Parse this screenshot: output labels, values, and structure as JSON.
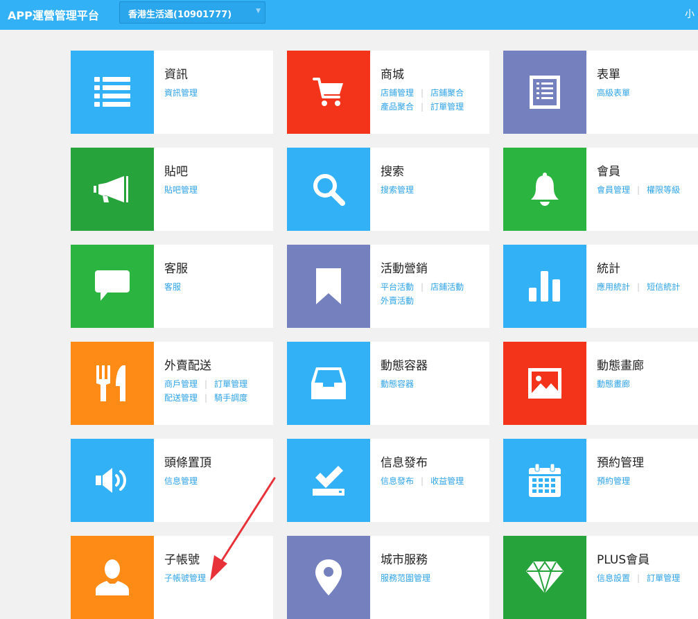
{
  "header": {
    "app_title": "APP運營管理平台",
    "store_select": {
      "selected": "香港生活通(10901777)"
    },
    "user_text": "小"
  },
  "colors": {
    "header": "#33b1f6",
    "blue": "#33b1f6",
    "red": "#f4331b",
    "purple": "#7581bf",
    "green": "#2bb540",
    "dark_green": "#26a33a",
    "orange": "#fd8b15",
    "link": "#2ea3e8",
    "arrow": "#e8323a"
  },
  "modules": [
    {
      "title": "資訊",
      "icon": "list-icon",
      "links": [
        "資訊管理"
      ]
    },
    {
      "title": "商城",
      "icon": "cart-icon",
      "links": [
        "店鋪管理",
        "店鋪聚合",
        "產品聚合",
        "訂單管理"
      ]
    },
    {
      "title": "表單",
      "icon": "form-icon",
      "links": [
        "高級表單"
      ]
    },
    {
      "title": "貼吧",
      "icon": "megaphone-icon",
      "links": [
        "貼吧管理"
      ]
    },
    {
      "title": "搜索",
      "icon": "search-icon",
      "links": [
        "搜索管理"
      ]
    },
    {
      "title": "會員",
      "icon": "bell-icon",
      "links": [
        "會員管理",
        "權限等級"
      ]
    },
    {
      "title": "客服",
      "icon": "chat-bubble-icon",
      "links": [
        "客服"
      ]
    },
    {
      "title": "活動營銷",
      "icon": "bookmark-icon",
      "links": [
        "平台活動",
        "店鋪活動",
        "外賣活動"
      ]
    },
    {
      "title": "統計",
      "icon": "bar-chart-icon",
      "links": [
        "應用統計",
        "短信統計"
      ]
    },
    {
      "title": "外賣配送",
      "icon": "fork-knife-icon",
      "links": [
        "商戶管理",
        "訂單管理",
        "配送管理",
        "騎手調度"
      ]
    },
    {
      "title": "動態容器",
      "icon": "inbox-tray-icon",
      "links": [
        "動態容器"
      ]
    },
    {
      "title": "動態畫廊",
      "icon": "picture-icon",
      "links": [
        "動態畫廊"
      ]
    },
    {
      "title": "頭條置頂",
      "icon": "speaker-icon",
      "links": [
        "信息管理"
      ]
    },
    {
      "title": "信息發布",
      "icon": "checkmark-tray-icon",
      "links": [
        "信息發布",
        "收益管理"
      ]
    },
    {
      "title": "預約管理",
      "icon": "calendar-icon",
      "links": [
        "預約管理"
      ]
    },
    {
      "title": "子帳號",
      "icon": "user-icon",
      "links": [
        "子帳號管理"
      ]
    },
    {
      "title": "城市服務",
      "icon": "location-pin-icon",
      "links": [
        "服務范圍管理"
      ]
    },
    {
      "title": "PLUS會員",
      "icon": "diamond-icon",
      "links": [
        "信息設置",
        "訂單管理"
      ]
    }
  ]
}
